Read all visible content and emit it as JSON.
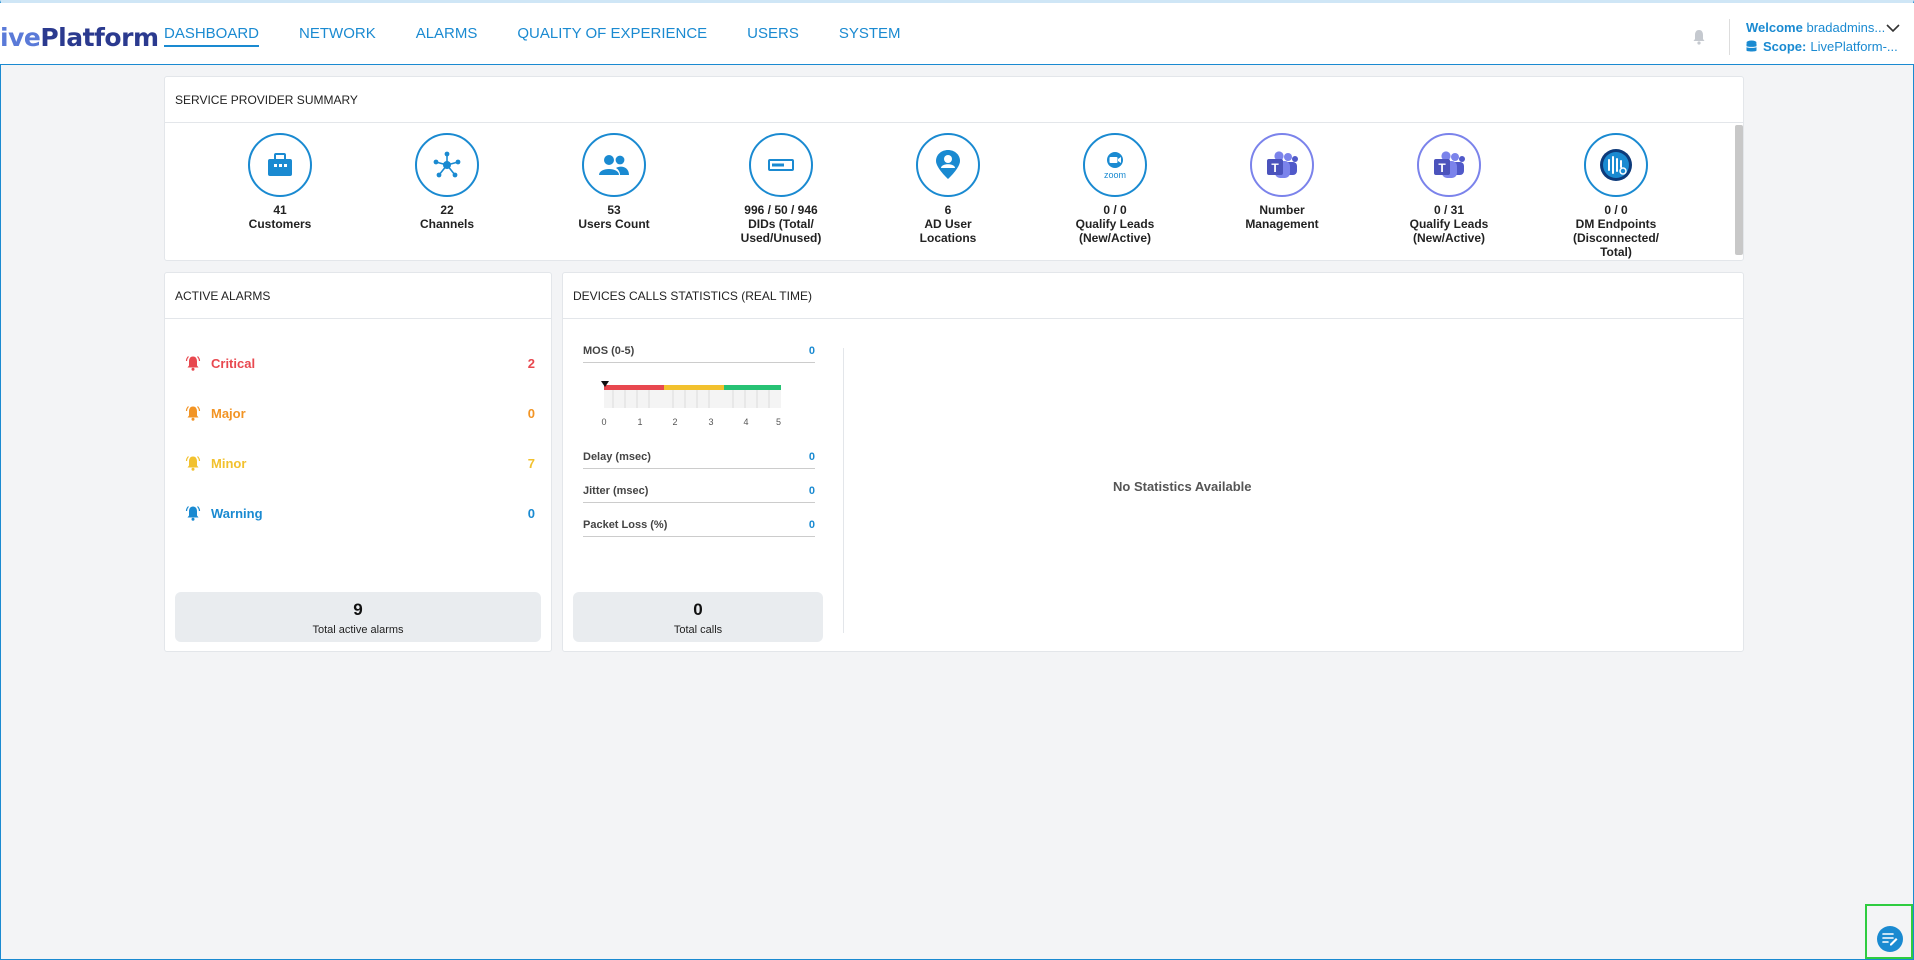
{
  "logo": {
    "text_prefix": "i",
    "text_accent": "ve",
    "text_main": "Platform"
  },
  "nav": {
    "items": [
      {
        "label": "DASHBOARD",
        "active": true
      },
      {
        "label": "NETWORK"
      },
      {
        "label": "ALARMS"
      },
      {
        "label": "QUALITY OF EXPERIENCE"
      },
      {
        "label": "USERS"
      },
      {
        "label": "SYSTEM"
      }
    ]
  },
  "user": {
    "welcome_label": "Welcome",
    "username": "bradadmins...",
    "scope_label": "Scope:",
    "scope_value": "LivePlatform-..."
  },
  "summary": {
    "title": "SERVICE PROVIDER SUMMARY",
    "items": [
      {
        "value": "41",
        "label": "Customers",
        "icon": "briefcase-icon"
      },
      {
        "value": "22",
        "label": "Channels",
        "icon": "network-hub-icon"
      },
      {
        "value": "53",
        "label": "Users Count",
        "icon": "users-icon"
      },
      {
        "value": "996 / 50 / 946",
        "label": "DIDs (Total/ Used/Unused)",
        "icon": "did-icon"
      },
      {
        "value": "6",
        "label": "AD User Locations",
        "icon": "user-location-icon"
      },
      {
        "value": "0 / 0",
        "label": "Qualify Leads (New/Active)",
        "icon": "zoom-icon"
      },
      {
        "value": "Number",
        "label": "Management",
        "icon": "teams-icon"
      },
      {
        "value": "0 / 31",
        "label": "Qualify Leads (New/Active)",
        "icon": "teams-icon"
      },
      {
        "value": "0 / 0",
        "label": "DM Endpoints (Disconnected/ Total)",
        "icon": "endpoints-icon"
      }
    ]
  },
  "alarms": {
    "title": "ACTIVE ALARMS",
    "rows": [
      {
        "label": "Critical",
        "count": "2",
        "color": "#e8484f"
      },
      {
        "label": "Major",
        "count": "0",
        "color": "#f29424"
      },
      {
        "label": "Minor",
        "count": "7",
        "color": "#f2c12e"
      },
      {
        "label": "Warning",
        "count": "0",
        "color": "#1a8ad1"
      }
    ],
    "total_value": "9",
    "total_label": "Total active alarms"
  },
  "calls": {
    "title": "DEVICES CALLS STATISTICS (REAL TIME)",
    "mos": {
      "label": "MOS (0-5)",
      "value": "0"
    },
    "gauge_ticks": [
      "0",
      "1",
      "2",
      "3",
      "4",
      "5"
    ],
    "delay": {
      "label": "Delay (msec)",
      "value": "0"
    },
    "jitter": {
      "label": "Jitter (msec)",
      "value": "0"
    },
    "packet_loss": {
      "label": "Packet Loss (%)",
      "value": "0"
    },
    "total_value": "0",
    "total_label": "Total calls",
    "no_stats": "No Statistics Available"
  },
  "colors": {
    "accent": "#1a8ad1",
    "teams": "#7b83eb",
    "gauge_red": "#e8484f",
    "gauge_yellow": "#f2c12e",
    "gauge_green": "#27c274"
  }
}
